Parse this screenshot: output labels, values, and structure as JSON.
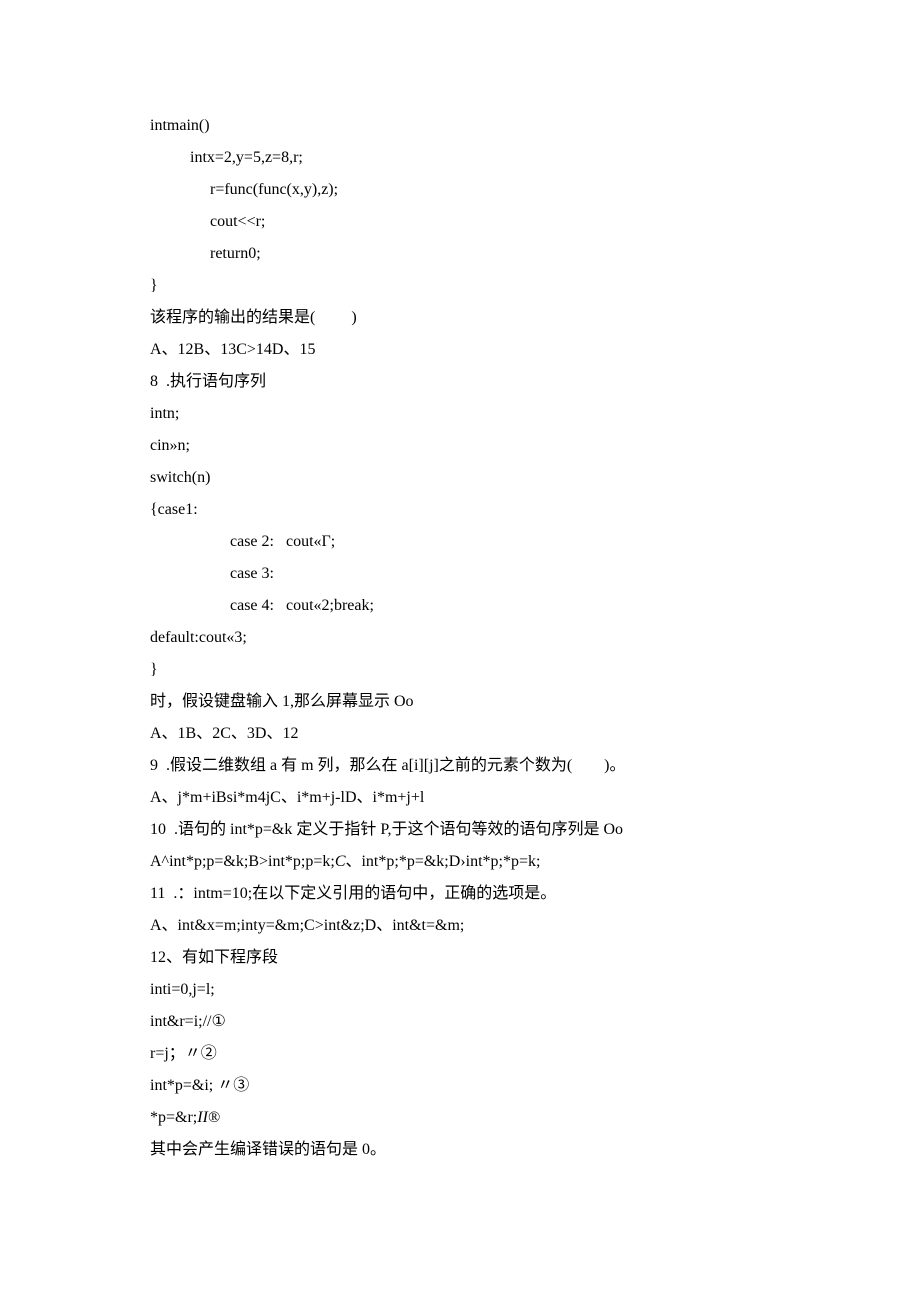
{
  "lines": {
    "l1": "intmain()",
    "l2": "intx=2,y=5,z=8,r;",
    "l3": "r=func(func(x,y),z);",
    "l4": "cout<<r;",
    "l5": "return0;",
    "l6": "}",
    "l7": "该程序的输出的结果是(         )",
    "l8": "A、12B、13C>14D、15",
    "l9": "8  .执行语句序列",
    "l10": "intn;",
    "l11": "cin»n;",
    "l12": "switch(n)",
    "l13": "{case1:",
    "l14": "case 2:   cout«Γ;",
    "l15": "case 3:",
    "l16": "case 4:   cout«2;break;",
    "l17": "default:cout«3;",
    "l18": "}",
    "l19": "时，假设键盘输入 1,那么屏幕显示 Oo",
    "l20": "A、1B、2C、3D、12",
    "l21": "9  .假设二维数组 a 有 m 列，那么在 a[i][j]之前的元素个数为(        )。",
    "l22": "A、j*m+iBsi*m4jC、i*m+j-lD、i*m+j+l",
    "l23": "10  .语句的 int*p=&k 定义于指针 P,于这个语句等效的语句序列是 Oo",
    "l24_a": "A^int*p;p=&k;B>int*p;p=k;",
    "l24_b": "C",
    "l24_c": "、int*p;*p=&k;D›int*p;*p=k;",
    "l25": "11  .：intm=10;在以下定义引用的语句中，正确的选项是。",
    "l26": "A、int&x=m;inty=&m;C>int&z;D、int&t=&m;",
    "l27": "12、有如下程序段",
    "l28": "inti=0,j=l;",
    "l29": "int&r=i;//①",
    "l30": "r=j；〃②",
    "l31": "int*p=&i; 〃③",
    "l32_a": "*p=&r;",
    "l32_b": "II®",
    "l33": "其中会产生编译错误的语句是 0。"
  }
}
